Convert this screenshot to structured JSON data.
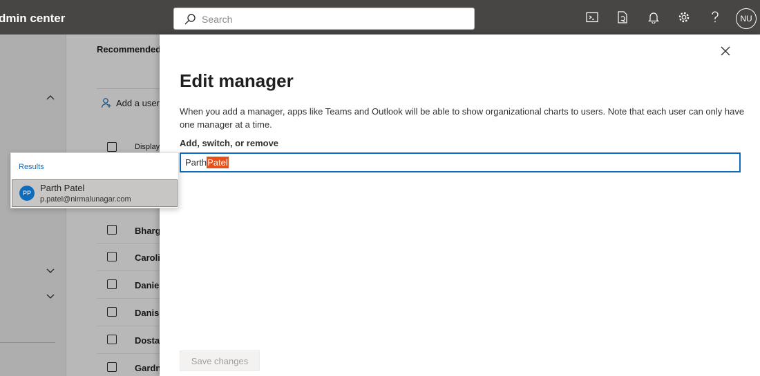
{
  "header": {
    "app_title": "dmin center",
    "search_placeholder": "Search",
    "user_initials": "NU"
  },
  "background": {
    "section_heading": "Recommended",
    "add_user_label": "Add a user",
    "column_display_name": "Display",
    "rows": [
      "Bharg",
      "Caroli",
      "Danie",
      "Danish",
      "Dosta",
      "Gardn"
    ]
  },
  "panel": {
    "title": "Edit manager",
    "description": "When you add a manager, apps like Teams and Outlook will be able to show organizational charts to users. Note that each user can only have one manager at a time.",
    "field_label": "Add, switch, or remove",
    "input_value_typed": "Parth",
    "input_value_selected": "Patel",
    "save_label": "Save changes"
  },
  "results": {
    "label": "Results",
    "items": [
      {
        "initials": "PP",
        "name": "Parth Patel",
        "email": "p.patel@nirmalunagar.com"
      }
    ]
  },
  "colors": {
    "topbar": "#484644",
    "accent": "#0f6cbd",
    "selection": "#e5501b"
  }
}
